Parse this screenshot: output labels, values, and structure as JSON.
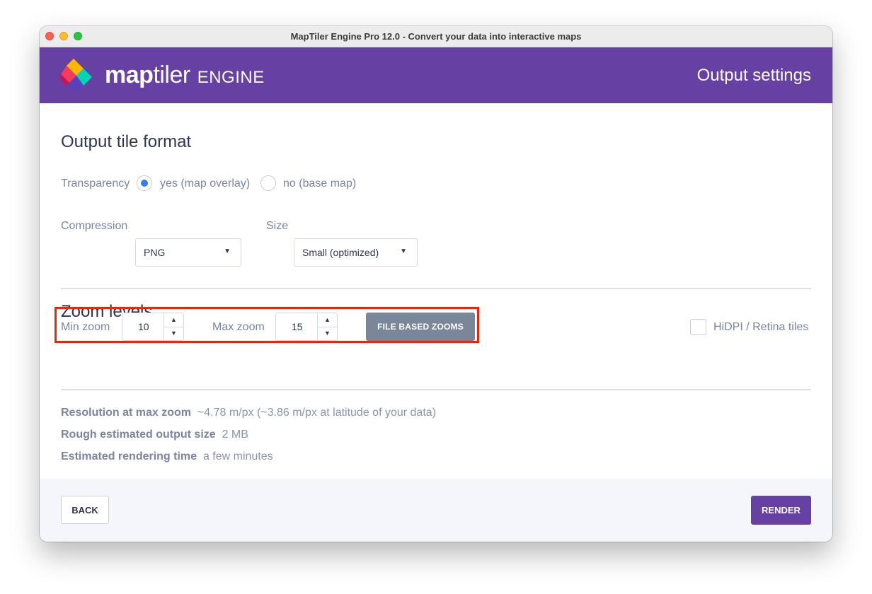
{
  "window": {
    "title": "MapTiler Engine Pro 12.0 - Convert your data into interactive maps"
  },
  "header": {
    "brand_map": "map",
    "brand_tiler": "tiler",
    "brand_engine": "ENGINE",
    "page_title": "Output settings",
    "logo_colors": [
      "#f23b5f",
      "#ffb700",
      "#00d6b4",
      "#5a3fc0"
    ]
  },
  "output_format": {
    "title": "Output tile format",
    "transparency_label": "Transparency",
    "transparency_options": [
      {
        "label": "yes (map overlay)",
        "selected": true
      },
      {
        "label": "no (base map)",
        "selected": false
      }
    ],
    "compression_label": "Compression",
    "compression_value": "PNG",
    "size_label": "Size",
    "size_value": "Small (optimized)"
  },
  "zoom": {
    "title": "Zoom levels",
    "min_label": "Min zoom",
    "min_value": "10",
    "max_label": "Max zoom",
    "max_value": "15",
    "file_based_button": "FILE BASED ZOOMS",
    "hidpi_label": "HiDPI / Retina tiles",
    "hidpi_checked": false
  },
  "stats": {
    "resolution_label": "Resolution at max zoom",
    "resolution_value": "~4.78 m/px (~3.86 m/px at latitude of your data)",
    "size_label": "Rough estimated output size",
    "size_value": "2 MB",
    "time_label": "Estimated rendering time",
    "time_value": "a few minutes"
  },
  "footer": {
    "back_label": "BACK",
    "render_label": "RENDER"
  },
  "colors": {
    "accent": "#6641a3",
    "radio_selected": "#2f7ef6",
    "highlight": "#f0240b"
  }
}
